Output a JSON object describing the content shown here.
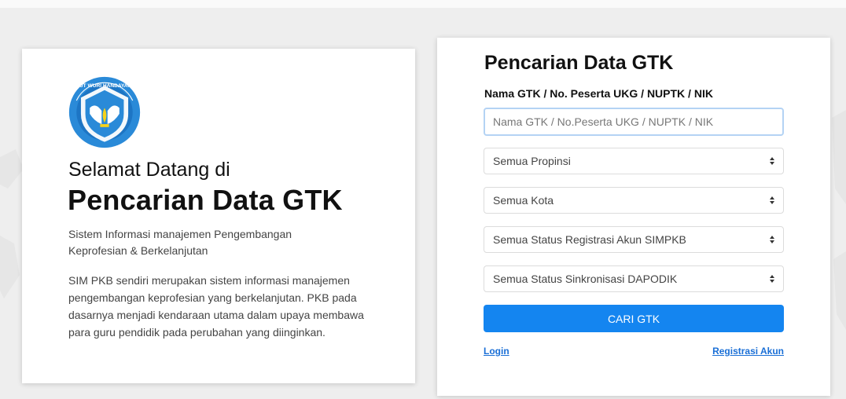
{
  "welcome_card": {
    "greeting": "Selamat Datang di",
    "title": "Pencarian Data GTK",
    "subtitle": "Sistem Informasi manajemen Pengembangan Keprofesian & Berkelanjutan",
    "description": "SIM PKB sendiri merupakan sistem informasi manajemen pengembangan keprofesian yang berkelanjutan. PKB pada dasarnya menjadi kendaraan utama dalam upaya membawa para guru pendidik pada perubahan yang diinginkan.",
    "logo_icon": "tut-wuri-handayani-logo-icon",
    "logo_text": "TUT WURI HANDAYANI"
  },
  "search_form": {
    "title": "Pencarian Data GTK",
    "field_label": "Nama GTK / No. Peserta UKG / NUPTK / NIK",
    "search_placeholder": "Nama GTK / No.Peserta UKG / NUPTK / NIK",
    "search_value": "",
    "selects": {
      "province": "Semua Propinsi",
      "city": "Semua Kota",
      "registration_status": "Semua Status Registrasi Akun SIMPKB",
      "sync_status": "Semua Status Sinkronisasi DAPODIK"
    },
    "submit_label": "CARI GTK",
    "login_link": "Login",
    "register_link": "Registrasi Akun"
  },
  "colors": {
    "primary_button": "#1485f0",
    "link": "#1a6fd6",
    "input_focus_border": "#b4d3f4",
    "logo_blue": "#2a8ad8"
  }
}
